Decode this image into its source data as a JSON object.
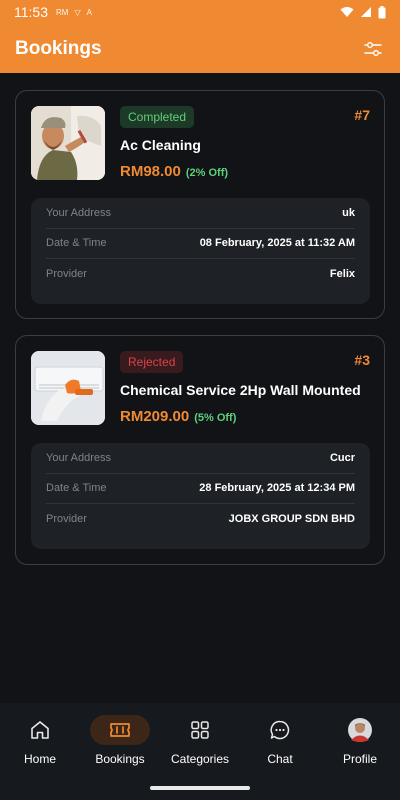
{
  "status_bar": {
    "time": "11:53",
    "notif1": "RM",
    "notif2": "▽",
    "notif3": "A"
  },
  "header": {
    "title": "Bookings"
  },
  "bookings": [
    {
      "status": "Completed",
      "order_no": "#7",
      "service": "Ac Cleaning",
      "price": "RM98.00",
      "discount": "(2% Off)",
      "details": [
        {
          "label": "Your Address",
          "value": "uk"
        },
        {
          "label": "Date & Time",
          "value": "08 February, 2025 at 11:32 AM"
        },
        {
          "label": "Provider",
          "value": "Felix"
        }
      ]
    },
    {
      "status": "Rejected",
      "order_no": "#3",
      "service": "Chemical Service 2Hp Wall Mounted",
      "price": "RM209.00",
      "discount": "(5% Off)",
      "details": [
        {
          "label": "Your Address",
          "value": "Cucr"
        },
        {
          "label": "Date & Time",
          "value": "28 February, 2025 at 12:34 PM"
        },
        {
          "label": "Provider",
          "value": "JOBX GROUP SDN BHD"
        }
      ]
    }
  ],
  "nav": [
    {
      "label": "Home",
      "icon": "home-icon"
    },
    {
      "label": "Bookings",
      "icon": "ticket-icon",
      "active": true
    },
    {
      "label": "Categories",
      "icon": "grid-icon"
    },
    {
      "label": "Chat",
      "icon": "chat-icon"
    },
    {
      "label": "Profile",
      "icon": "avatar"
    }
  ],
  "colors": {
    "accent": "#ef8a32",
    "success": "#5fd07a",
    "danger": "#d9434b",
    "background": "#111317"
  }
}
